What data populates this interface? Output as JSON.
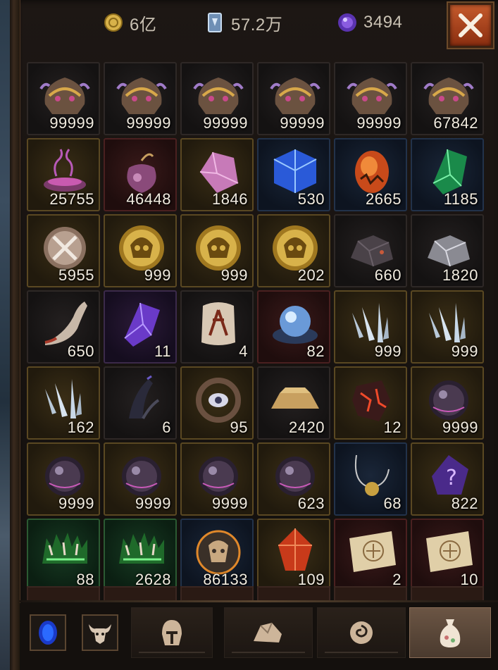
{
  "currencies": {
    "gold": {
      "icon": "gold-coin-icon",
      "value": "6亿",
      "color": "#d8b24a"
    },
    "card": {
      "icon": "crystal-card-icon",
      "value": "57.2万",
      "color": "#a9c6e8"
    },
    "orb": {
      "icon": "purple-orb-icon",
      "value": "3494",
      "color": "#8a5ce0"
    }
  },
  "close_button": {
    "icon": "close-icon"
  },
  "inventory": [
    {
      "icon": "dragon-helm-icon",
      "count": "99999",
      "quality": "gray"
    },
    {
      "icon": "dragon-helm-icon",
      "count": "99999",
      "quality": "gray"
    },
    {
      "icon": "dragon-helm-icon",
      "count": "99999",
      "quality": "gray"
    },
    {
      "icon": "dragon-helm-icon",
      "count": "99999",
      "quality": "gray"
    },
    {
      "icon": "dragon-helm-icon",
      "count": "99999",
      "quality": "gray"
    },
    {
      "icon": "dragon-helm-icon",
      "count": "67842",
      "quality": "gray"
    },
    {
      "icon": "smoking-cauldron-icon",
      "count": "25755",
      "quality": "gold"
    },
    {
      "icon": "purple-pouch-icon",
      "count": "46448",
      "quality": "red"
    },
    {
      "icon": "pink-crystal-icon",
      "count": "1846",
      "quality": "gold"
    },
    {
      "icon": "blue-cube-icon",
      "count": "530",
      "quality": "blue"
    },
    {
      "icon": "fire-egg-icon",
      "count": "2665",
      "quality": "blue"
    },
    {
      "icon": "green-crystal-icon",
      "count": "1185",
      "quality": "blue"
    },
    {
      "icon": "crossed-swords-medal-icon",
      "count": "5955",
      "quality": "gold"
    },
    {
      "icon": "golden-skull-coin-icon",
      "count": "999",
      "quality": "gold"
    },
    {
      "icon": "golden-skull-coin-icon",
      "count": "999",
      "quality": "gold"
    },
    {
      "icon": "golden-skull-coin-icon",
      "count": "202",
      "quality": "gold"
    },
    {
      "icon": "dark-ore-icon",
      "count": "660",
      "quality": "gray"
    },
    {
      "icon": "silver-ore-icon",
      "count": "1820",
      "quality": "gray"
    },
    {
      "icon": "bone-horn-icon",
      "count": "650",
      "quality": "gray"
    },
    {
      "icon": "amethyst-shard-icon",
      "count": "11",
      "quality": "purple"
    },
    {
      "icon": "rune-stone-icon",
      "count": "4",
      "quality": "gray"
    },
    {
      "icon": "blue-egg-nest-icon",
      "count": "82",
      "quality": "red"
    },
    {
      "icon": "ice-crystal-cluster-icon",
      "count": "999",
      "quality": "gold"
    },
    {
      "icon": "ice-crystal-cluster-icon",
      "count": "999",
      "quality": "gold"
    },
    {
      "icon": "ice-crystal-cluster-icon",
      "count": "162",
      "quality": "gold"
    },
    {
      "icon": "dark-claw-icon",
      "count": "6",
      "quality": "gray"
    },
    {
      "icon": "eye-amulet-icon",
      "count": "95",
      "quality": "gold"
    },
    {
      "icon": "gold-bar-icon",
      "count": "2420",
      "quality": "gray"
    },
    {
      "icon": "lava-stone-icon",
      "count": "12",
      "quality": "gold"
    },
    {
      "icon": "dark-pearl-icon",
      "count": "9999",
      "quality": "gold"
    },
    {
      "icon": "dark-pearl-icon",
      "count": "9999",
      "quality": "gold"
    },
    {
      "icon": "dark-pearl-icon",
      "count": "9999",
      "quality": "gold"
    },
    {
      "icon": "dark-pearl-icon",
      "count": "9999",
      "quality": "gold"
    },
    {
      "icon": "dark-pearl-icon",
      "count": "623",
      "quality": "gold"
    },
    {
      "icon": "fishing-hook-icon",
      "count": "68",
      "quality": "blue"
    },
    {
      "icon": "mystery-rune-icon",
      "count": "822",
      "quality": "gold"
    },
    {
      "icon": "green-antler-crown-icon",
      "count": "88",
      "quality": "green"
    },
    {
      "icon": "green-antler-crown-icon",
      "count": "2628",
      "quality": "green"
    },
    {
      "icon": "demon-shield-icon",
      "count": "86133",
      "quality": "blue"
    },
    {
      "icon": "ruby-crystal-icon",
      "count": "109",
      "quality": "gold"
    },
    {
      "icon": "treasure-map-icon",
      "count": "2",
      "quality": "red"
    },
    {
      "icon": "treasure-map-icon",
      "count": "10",
      "quality": "red"
    }
  ],
  "bottom_bar": {
    "buttons": [
      {
        "icon": "blue-portal-icon"
      },
      {
        "icon": "bull-skull-icon"
      }
    ],
    "tabs": [
      {
        "icon": "helmet-icon",
        "active": false
      },
      {
        "icon": "stone-pile-icon",
        "active": false
      },
      {
        "icon": "swirl-rune-icon",
        "active": false
      },
      {
        "icon": "loot-bag-icon",
        "active": true
      }
    ]
  }
}
